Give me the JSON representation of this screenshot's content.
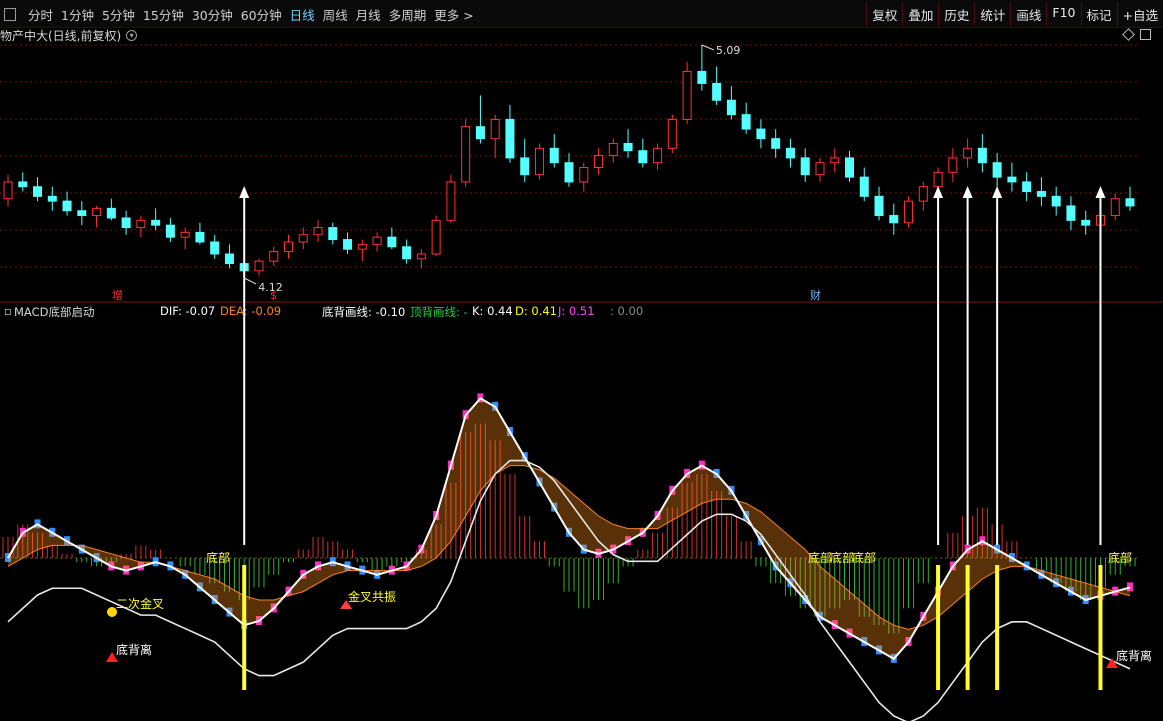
{
  "toolbar": {
    "periods": [
      "分时",
      "1分钟",
      "5分钟",
      "15分钟",
      "30分钟",
      "60分钟",
      "日线",
      "周线",
      "月线",
      "多周期"
    ],
    "active": "日线",
    "more": "更多 >",
    "right_buttons": [
      "复权",
      "叠加",
      "历史",
      "统计",
      "画线",
      "F10",
      "标记",
      "+自选"
    ]
  },
  "main_chart": {
    "title": "物产中大(日线,前复权)",
    "high_label": "5.09",
    "low_label": "4.12",
    "badges": [
      "增",
      "$",
      "财"
    ]
  },
  "indicator": {
    "name": "MACD底部启动",
    "dif": {
      "label": "DIF: -0.07",
      "color": "#ffffff"
    },
    "dea": {
      "label": "DEA: -0.09",
      "color": "#ff7f27"
    },
    "dbhx": {
      "label": "底背画线: -0.10",
      "color": "#ffffff"
    },
    "dbhx2": {
      "label": "顶背画线: -",
      "color": "#2ecc40"
    },
    "k": {
      "label": "K: 0.44",
      "color": "#ffffff"
    },
    "d": {
      "label": "D: 0.41",
      "color": "#ffff00"
    },
    "j": {
      "label": "J: 0.51",
      "color": "#ff44ff"
    },
    "extra": {
      "label": ": 0.00",
      "color": "#888888"
    },
    "annotations": [
      "二次金叉",
      "金叉共振",
      "底背离",
      "底背离",
      "底部",
      "底部",
      "底部",
      "底部",
      "底部"
    ]
  },
  "chart_data": {
    "type": "candlestick+indicator",
    "price_high": 5.09,
    "price_low": 4.12,
    "up_color": "#ff3232",
    "down_color": "#54ffff",
    "ohlc": [
      [
        4.45,
        4.55,
        4.42,
        4.52
      ],
      [
        4.52,
        4.56,
        4.48,
        4.5
      ],
      [
        4.5,
        4.54,
        4.44,
        4.46
      ],
      [
        4.46,
        4.5,
        4.4,
        4.44
      ],
      [
        4.44,
        4.48,
        4.38,
        4.4
      ],
      [
        4.4,
        4.44,
        4.34,
        4.38
      ],
      [
        4.38,
        4.42,
        4.33,
        4.41
      ],
      [
        4.41,
        4.45,
        4.36,
        4.37
      ],
      [
        4.37,
        4.4,
        4.3,
        4.33
      ],
      [
        4.33,
        4.38,
        4.29,
        4.36
      ],
      [
        4.36,
        4.41,
        4.32,
        4.34
      ],
      [
        4.34,
        4.37,
        4.27,
        4.29
      ],
      [
        4.29,
        4.33,
        4.24,
        4.31
      ],
      [
        4.31,
        4.35,
        4.26,
        4.27
      ],
      [
        4.27,
        4.3,
        4.2,
        4.22
      ],
      [
        4.22,
        4.26,
        4.16,
        4.18
      ],
      [
        4.18,
        4.22,
        4.12,
        4.15
      ],
      [
        4.15,
        4.2,
        4.13,
        4.19
      ],
      [
        4.19,
        4.25,
        4.17,
        4.23
      ],
      [
        4.23,
        4.3,
        4.2,
        4.27
      ],
      [
        4.27,
        4.33,
        4.24,
        4.3
      ],
      [
        4.3,
        4.36,
        4.27,
        4.33
      ],
      [
        4.33,
        4.35,
        4.26,
        4.28
      ],
      [
        4.28,
        4.31,
        4.22,
        4.24
      ],
      [
        4.24,
        4.28,
        4.19,
        4.26
      ],
      [
        4.26,
        4.31,
        4.23,
        4.29
      ],
      [
        4.29,
        4.33,
        4.24,
        4.25
      ],
      [
        4.25,
        4.28,
        4.18,
        4.2
      ],
      [
        4.2,
        4.24,
        4.16,
        4.22
      ],
      [
        4.22,
        4.38,
        4.21,
        4.36
      ],
      [
        4.36,
        4.55,
        4.35,
        4.52
      ],
      [
        4.52,
        4.78,
        4.5,
        4.75
      ],
      [
        4.75,
        4.88,
        4.68,
        4.7
      ],
      [
        4.7,
        4.8,
        4.62,
        4.78
      ],
      [
        4.78,
        4.84,
        4.6,
        4.62
      ],
      [
        4.62,
        4.7,
        4.52,
        4.55
      ],
      [
        4.55,
        4.68,
        4.53,
        4.66
      ],
      [
        4.66,
        4.72,
        4.58,
        4.6
      ],
      [
        4.6,
        4.64,
        4.5,
        4.52
      ],
      [
        4.52,
        4.6,
        4.48,
        4.58
      ],
      [
        4.58,
        4.66,
        4.55,
        4.63
      ],
      [
        4.63,
        4.7,
        4.6,
        4.68
      ],
      [
        4.68,
        4.74,
        4.62,
        4.65
      ],
      [
        4.65,
        4.7,
        4.58,
        4.6
      ],
      [
        4.6,
        4.68,
        4.57,
        4.66
      ],
      [
        4.66,
        4.8,
        4.64,
        4.78
      ],
      [
        4.78,
        5.02,
        4.76,
        4.98
      ],
      [
        4.98,
        5.09,
        4.9,
        4.93
      ],
      [
        4.93,
        5.0,
        4.84,
        4.86
      ],
      [
        4.86,
        4.92,
        4.78,
        4.8
      ],
      [
        4.8,
        4.85,
        4.72,
        4.74
      ],
      [
        4.74,
        4.78,
        4.66,
        4.7
      ],
      [
        4.7,
        4.74,
        4.62,
        4.66
      ],
      [
        4.66,
        4.7,
        4.58,
        4.62
      ],
      [
        4.62,
        4.66,
        4.52,
        4.55
      ],
      [
        4.55,
        4.62,
        4.52,
        4.6
      ],
      [
        4.6,
        4.66,
        4.56,
        4.62
      ],
      [
        4.62,
        4.65,
        4.52,
        4.54
      ],
      [
        4.54,
        4.58,
        4.44,
        4.46
      ],
      [
        4.46,
        4.5,
        4.36,
        4.38
      ],
      [
        4.38,
        4.43,
        4.3,
        4.35
      ],
      [
        4.35,
        4.46,
        4.33,
        4.44
      ],
      [
        4.44,
        4.52,
        4.4,
        4.5
      ],
      [
        4.5,
        4.58,
        4.46,
        4.56
      ],
      [
        4.56,
        4.66,
        4.52,
        4.62
      ],
      [
        4.62,
        4.7,
        4.58,
        4.66
      ],
      [
        4.66,
        4.72,
        4.56,
        4.6
      ],
      [
        4.6,
        4.64,
        4.5,
        4.54
      ],
      [
        4.54,
        4.6,
        4.48,
        4.52
      ],
      [
        4.52,
        4.56,
        4.44,
        4.48
      ],
      [
        4.48,
        4.54,
        4.42,
        4.46
      ],
      [
        4.46,
        4.5,
        4.38,
        4.42
      ],
      [
        4.42,
        4.46,
        4.32,
        4.36
      ],
      [
        4.36,
        4.4,
        4.3,
        4.34
      ],
      [
        4.34,
        4.4,
        4.31,
        4.38
      ],
      [
        4.38,
        4.47,
        4.36,
        4.45
      ],
      [
        4.45,
        4.5,
        4.4,
        4.42
      ]
    ],
    "macd_hist": [
      0.05,
      0.08,
      0.06,
      0.03,
      0.01,
      -0.01,
      -0.02,
      -0.01,
      0.01,
      0.03,
      0.02,
      0.0,
      -0.02,
      -0.04,
      -0.06,
      -0.08,
      -0.1,
      -0.07,
      -0.04,
      -0.01,
      0.02,
      0.05,
      0.04,
      0.02,
      -0.01,
      -0.03,
      -0.02,
      -0.01,
      0.02,
      0.08,
      0.18,
      0.3,
      0.32,
      0.28,
      0.2,
      0.1,
      0.04,
      -0.02,
      -0.08,
      -0.12,
      -0.1,
      -0.06,
      -0.02,
      0.02,
      0.06,
      0.12,
      0.18,
      0.2,
      0.16,
      0.1,
      0.04,
      -0.02,
      -0.06,
      -0.09,
      -0.12,
      -0.14,
      -0.12,
      -0.1,
      -0.14,
      -0.16,
      -0.18,
      -0.12,
      -0.06,
      0.0,
      0.06,
      0.1,
      0.12,
      0.08,
      0.04,
      0.0,
      -0.03,
      -0.06,
      -0.08,
      -0.1,
      -0.07,
      -0.04,
      -0.02
    ],
    "dif": [
      0.0,
      0.06,
      0.08,
      0.06,
      0.04,
      0.02,
      0.0,
      -0.02,
      -0.03,
      -0.02,
      -0.01,
      -0.02,
      -0.04,
      -0.07,
      -0.1,
      -0.13,
      -0.16,
      -0.15,
      -0.12,
      -0.08,
      -0.04,
      -0.02,
      -0.01,
      -0.02,
      -0.03,
      -0.04,
      -0.03,
      -0.02,
      0.02,
      0.1,
      0.22,
      0.34,
      0.38,
      0.36,
      0.3,
      0.24,
      0.18,
      0.12,
      0.06,
      0.02,
      0.01,
      0.02,
      0.04,
      0.06,
      0.1,
      0.16,
      0.2,
      0.22,
      0.2,
      0.16,
      0.1,
      0.04,
      -0.02,
      -0.06,
      -0.1,
      -0.14,
      -0.16,
      -0.18,
      -0.2,
      -0.22,
      -0.24,
      -0.2,
      -0.14,
      -0.08,
      -0.02,
      0.02,
      0.04,
      0.02,
      0.0,
      -0.02,
      -0.04,
      -0.06,
      -0.08,
      -0.1,
      -0.09,
      -0.08,
      -0.07
    ],
    "dea": [
      -0.02,
      0.0,
      0.02,
      0.03,
      0.03,
      0.03,
      0.02,
      0.01,
      0.0,
      -0.01,
      -0.01,
      -0.02,
      -0.03,
      -0.04,
      -0.05,
      -0.07,
      -0.09,
      -0.1,
      -0.1,
      -0.09,
      -0.08,
      -0.06,
      -0.04,
      -0.03,
      -0.03,
      -0.03,
      -0.03,
      -0.03,
      -0.02,
      0.0,
      0.04,
      0.1,
      0.16,
      0.2,
      0.22,
      0.22,
      0.21,
      0.19,
      0.16,
      0.13,
      0.1,
      0.08,
      0.07,
      0.07,
      0.07,
      0.09,
      0.11,
      0.13,
      0.14,
      0.14,
      0.13,
      0.11,
      0.08,
      0.05,
      0.02,
      -0.02,
      -0.05,
      -0.08,
      -0.11,
      -0.14,
      -0.16,
      -0.17,
      -0.16,
      -0.14,
      -0.11,
      -0.08,
      -0.05,
      -0.03,
      -0.02,
      -0.02,
      -0.03,
      -0.04,
      -0.05,
      -0.06,
      -0.07,
      -0.08,
      -0.09
    ],
    "arrow_bars": [
      16,
      63,
      65,
      67,
      74
    ]
  }
}
